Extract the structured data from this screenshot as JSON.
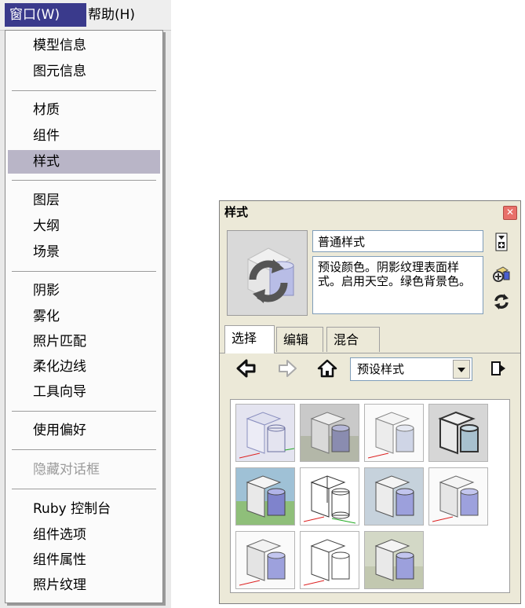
{
  "menubar": {
    "window_label": "窗口(W)",
    "help_label": "帮助(H)"
  },
  "window_menu": {
    "items": [
      {
        "label": "模型信息"
      },
      {
        "label": "图元信息"
      },
      {
        "label": "材质"
      },
      {
        "label": "组件"
      },
      {
        "label": "样式",
        "selected": true
      },
      {
        "label": "图层"
      },
      {
        "label": "大纲"
      },
      {
        "label": "场景"
      },
      {
        "label": "阴影"
      },
      {
        "label": "雾化"
      },
      {
        "label": "照片匹配"
      },
      {
        "label": "柔化边线"
      },
      {
        "label": "工具向导"
      },
      {
        "label": "使用偏好"
      },
      {
        "label": "隐藏对话框",
        "disabled": true
      },
      {
        "label": "Ruby 控制台"
      },
      {
        "label": "组件选项"
      },
      {
        "label": "组件属性"
      },
      {
        "label": "照片纹理"
      }
    ]
  },
  "styles_panel": {
    "title": "样式",
    "style_name": "普通样式",
    "style_description": "预设颜色。阴影纹理表面样式。启用天空。绿色背景色。",
    "tabs": [
      {
        "label": "选择"
      },
      {
        "label": "编辑"
      },
      {
        "label": "混合"
      }
    ],
    "collection_select": "预设样式",
    "thumbnail_count": 11
  },
  "colors": {
    "menu_highlight": "#b9b5c7",
    "active_menu": "#3a3a8c",
    "panel_bg": "#ece9d8"
  }
}
